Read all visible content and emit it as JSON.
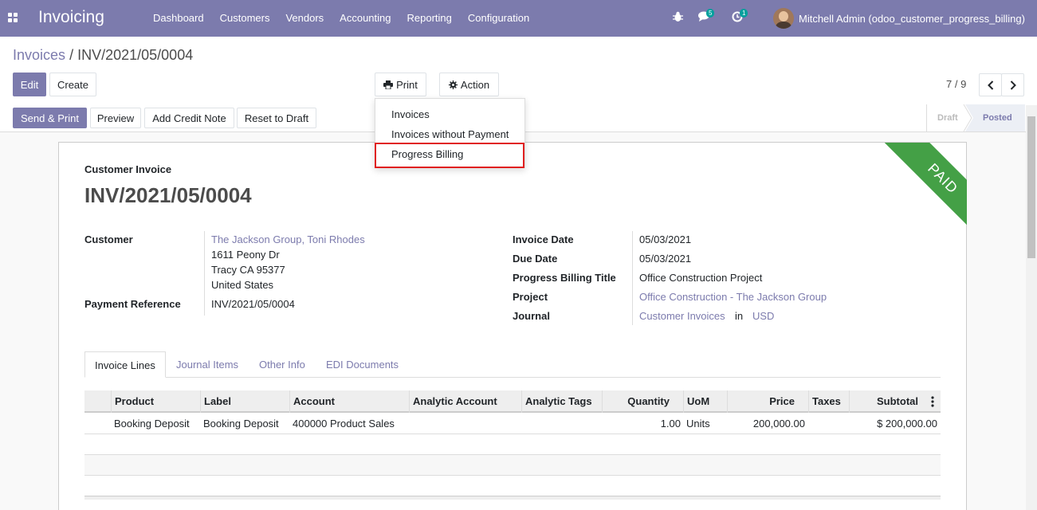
{
  "app": {
    "title": "Invoicing",
    "menu": [
      "Dashboard",
      "Customers",
      "Vendors",
      "Accounting",
      "Reporting",
      "Configuration"
    ],
    "messages_count": "5",
    "activities_count": "1",
    "user": "Mitchell Admin (odoo_customer_progress_billing)"
  },
  "breadcrumb": {
    "parent": "Invoices",
    "separator": "/",
    "current": "INV/2021/05/0004"
  },
  "buttons": {
    "edit": "Edit",
    "create": "Create",
    "print": "Print",
    "action": "Action"
  },
  "pager": {
    "value": "7 / 9"
  },
  "print_menu": [
    "Invoices",
    "Invoices without Payment",
    "Progress Billing"
  ],
  "statusbar": {
    "buttons": [
      "Send & Print",
      "Preview",
      "Add Credit Note",
      "Reset to Draft"
    ],
    "states": [
      "Draft",
      "Posted"
    ]
  },
  "ribbon": "PAID",
  "invoice": {
    "type": "Customer Invoice",
    "number": "INV/2021/05/0004",
    "customer_label": "Customer",
    "customer_name": "The Jackson Group, Toni Rhodes",
    "address": [
      "1611 Peony Dr",
      "Tracy CA 95377",
      "United States"
    ],
    "payment_ref_label": "Payment Reference",
    "payment_ref": "INV/2021/05/0004",
    "invoice_date_label": "Invoice Date",
    "invoice_date": "05/03/2021",
    "due_date_label": "Due Date",
    "due_date": "05/03/2021",
    "pb_title_label": "Progress Billing Title",
    "pb_title": "Office Construction Project",
    "project_label": "Project",
    "project": "Office Construction - The Jackson Group",
    "journal_label": "Journal",
    "journal": "Customer Invoices",
    "journal_in": "in",
    "currency": "USD"
  },
  "tabs": [
    "Invoice Lines",
    "Journal Items",
    "Other Info",
    "EDI Documents"
  ],
  "lines_table": {
    "headers": [
      "Product",
      "Label",
      "Account",
      "Analytic Account",
      "Analytic Tags",
      "Quantity",
      "UoM",
      "Price",
      "Taxes",
      "Subtotal"
    ],
    "rows": [
      [
        "Booking Deposit",
        "Booking Deposit",
        "400000 Product Sales",
        "",
        "",
        "1.00",
        "Units",
        "200,000.00",
        "",
        "$ 200,000.00"
      ]
    ]
  },
  "colors": {
    "brand": "#7c7bad",
    "ribbon": "#44a046",
    "highlight": "#e02020"
  }
}
